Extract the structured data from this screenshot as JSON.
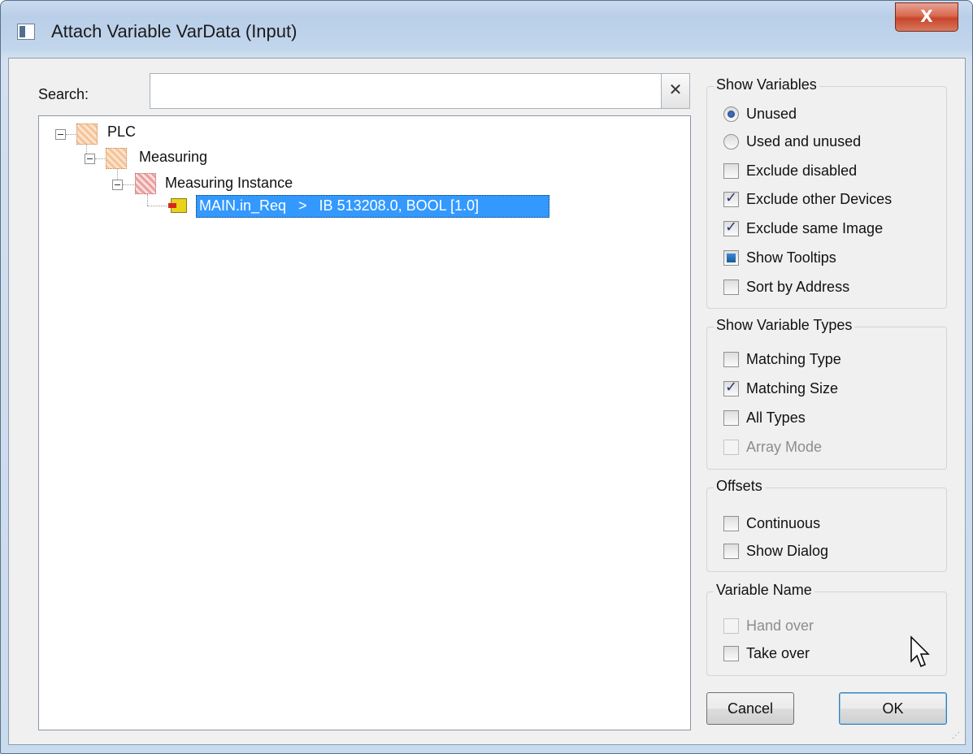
{
  "window": {
    "title": "Attach Variable VarData (Input)",
    "close_label": "X"
  },
  "search": {
    "label": "Search:",
    "value": "",
    "clear_label": "✕"
  },
  "tree": {
    "root": "PLC",
    "child": "Measuring",
    "instance": "Measuring Instance",
    "selected_item": "MAIN.in_Req   >   IB 513208.0, BOOL [1.0]"
  },
  "show_variables": {
    "title": "Show Variables",
    "unused": "Unused",
    "used_and_unused": "Used and unused",
    "exclude_disabled": "Exclude disabled",
    "exclude_other_devices": "Exclude other Devices",
    "exclude_same_image": "Exclude same Image",
    "show_tooltips": "Show Tooltips",
    "sort_by_address": "Sort by Address"
  },
  "show_variable_types": {
    "title": "Show Variable Types",
    "matching_type": "Matching Type",
    "matching_size": "Matching Size",
    "all_types": "All Types",
    "array_mode": "Array Mode"
  },
  "offsets": {
    "title": "Offsets",
    "continuous": "Continuous",
    "show_dialog": "Show Dialog"
  },
  "variable_name": {
    "title": "Variable Name",
    "hand_over": "Hand over",
    "take_over": "Take over"
  },
  "buttons": {
    "cancel": "Cancel",
    "ok": "OK"
  }
}
